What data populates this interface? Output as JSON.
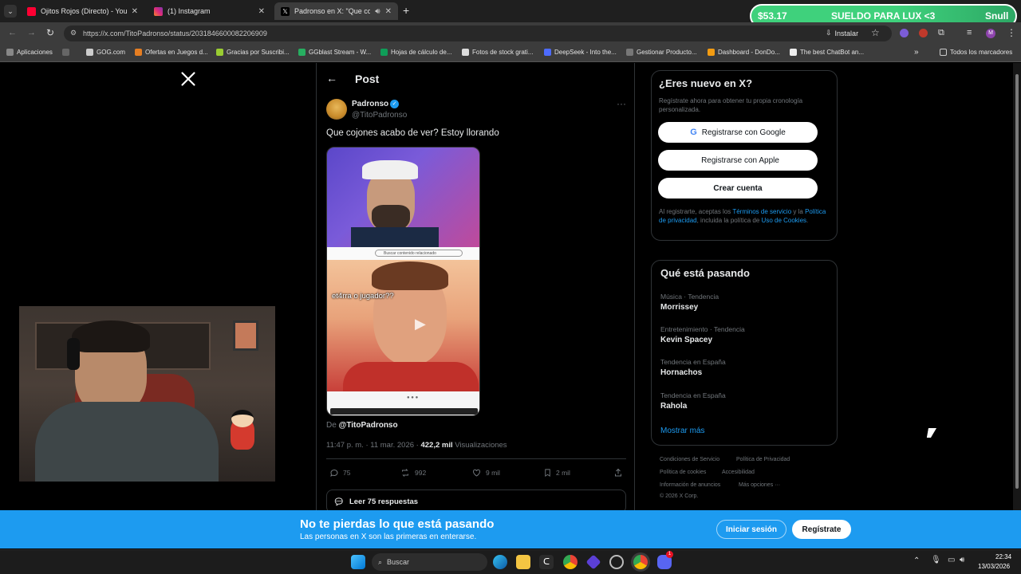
{
  "tabs": [
    {
      "label": "Ojitos Rojos (Directo) - YouTube",
      "icon": "youtube-icon",
      "color": "#ff0033"
    },
    {
      "label": "(1) Instagram",
      "icon": "instagram-icon",
      "color": "#d6249f"
    },
    {
      "label": "Padronso en X: \"Que cojone",
      "icon": "x-icon",
      "color": "#ffffff"
    }
  ],
  "url": "https://x.com/TitoPadronso/status/2031846600082206909",
  "install_label": "Instalar",
  "bookmarks": [
    "Aplicaciones",
    "GOG.com",
    "Ofertas en Juegos d...",
    "Gracias por Suscribi...",
    "GGblast Stream - W...",
    "Hojas de cálculo de...",
    "Fotos de stock grati...",
    "DeepSeek - Into the...",
    "Gestionar Producto...",
    "Dashboard - DonDo...",
    "The best ChatBot an...",
    "Todos los marcadores"
  ],
  "stream_overlay": {
    "amount": "$53.17",
    "goal": "SUELDO PARA LUX <3",
    "brand": "Snull"
  },
  "post": {
    "header": "Post",
    "author_name": "Padronso",
    "author_handle": "@TitoPadronso",
    "text": "Que cojones acabo de ver? Estoy llorando",
    "media_caption": "et4rra o jugador??",
    "media_search_text": "Buscar contenido relacionado",
    "from_prefix": "De",
    "from_handle": "@TitoPadronso",
    "timestamp": "11:47 p. m. · 11 mar. 2026 ·",
    "views_count": "422,2 mil",
    "views_label": "Visualizaciones",
    "replies": "75",
    "reposts": "992",
    "likes": "9 mil",
    "bookmarks": "2 mil",
    "read_replies": "Leer 75 respuestas"
  },
  "signup": {
    "title": "¿Eres nuevo en X?",
    "subtitle": "Regístrate ahora para obtener tu propia cronología personalizada.",
    "google": "Registrarse con Google",
    "apple": "Registrarse con Apple",
    "create": "Crear cuenta",
    "legal_1": "Al registrarte, aceptas los",
    "legal_terms": "Términos de servicio",
    "legal_2": "y la",
    "legal_privacy": "Política de privacidad",
    "legal_3": ", incluida la política de",
    "legal_cookies": "Uso de Cookies",
    "legal_end": "."
  },
  "trending": {
    "title": "Qué está pasando",
    "items": [
      {
        "category": "Música · Tendencia",
        "name": "Morrissey"
      },
      {
        "category": "Entretenimiento · Tendencia",
        "name": "Kevin Spacey"
      },
      {
        "category": "Tendencia en España",
        "name": "Hornachos"
      },
      {
        "category": "Tendencia en España",
        "name": "Rahola"
      }
    ],
    "more": "Mostrar más"
  },
  "footer": {
    "terms": "Condiciones de Servicio",
    "privacy": "Política de Privacidad",
    "cookies": "Política de cookies",
    "accessibility": "Accesibilidad",
    "ads": "Información de anuncios",
    "more": "Más opciones ···",
    "copyright": "© 2026 X Corp."
  },
  "banner": {
    "title": "No te pierdas lo que está pasando",
    "subtitle": "Las personas en X son las primeras en enterarse.",
    "login": "Iniciar sesión",
    "register": "Regístrate"
  },
  "taskbar": {
    "search": "Buscar",
    "time": "22:34",
    "date": "13/03/2026",
    "badge": "1"
  },
  "colors": {
    "x_blue": "#1d9bf0",
    "link": "#1d9bf0",
    "overlay_green": "#3fd17c"
  }
}
